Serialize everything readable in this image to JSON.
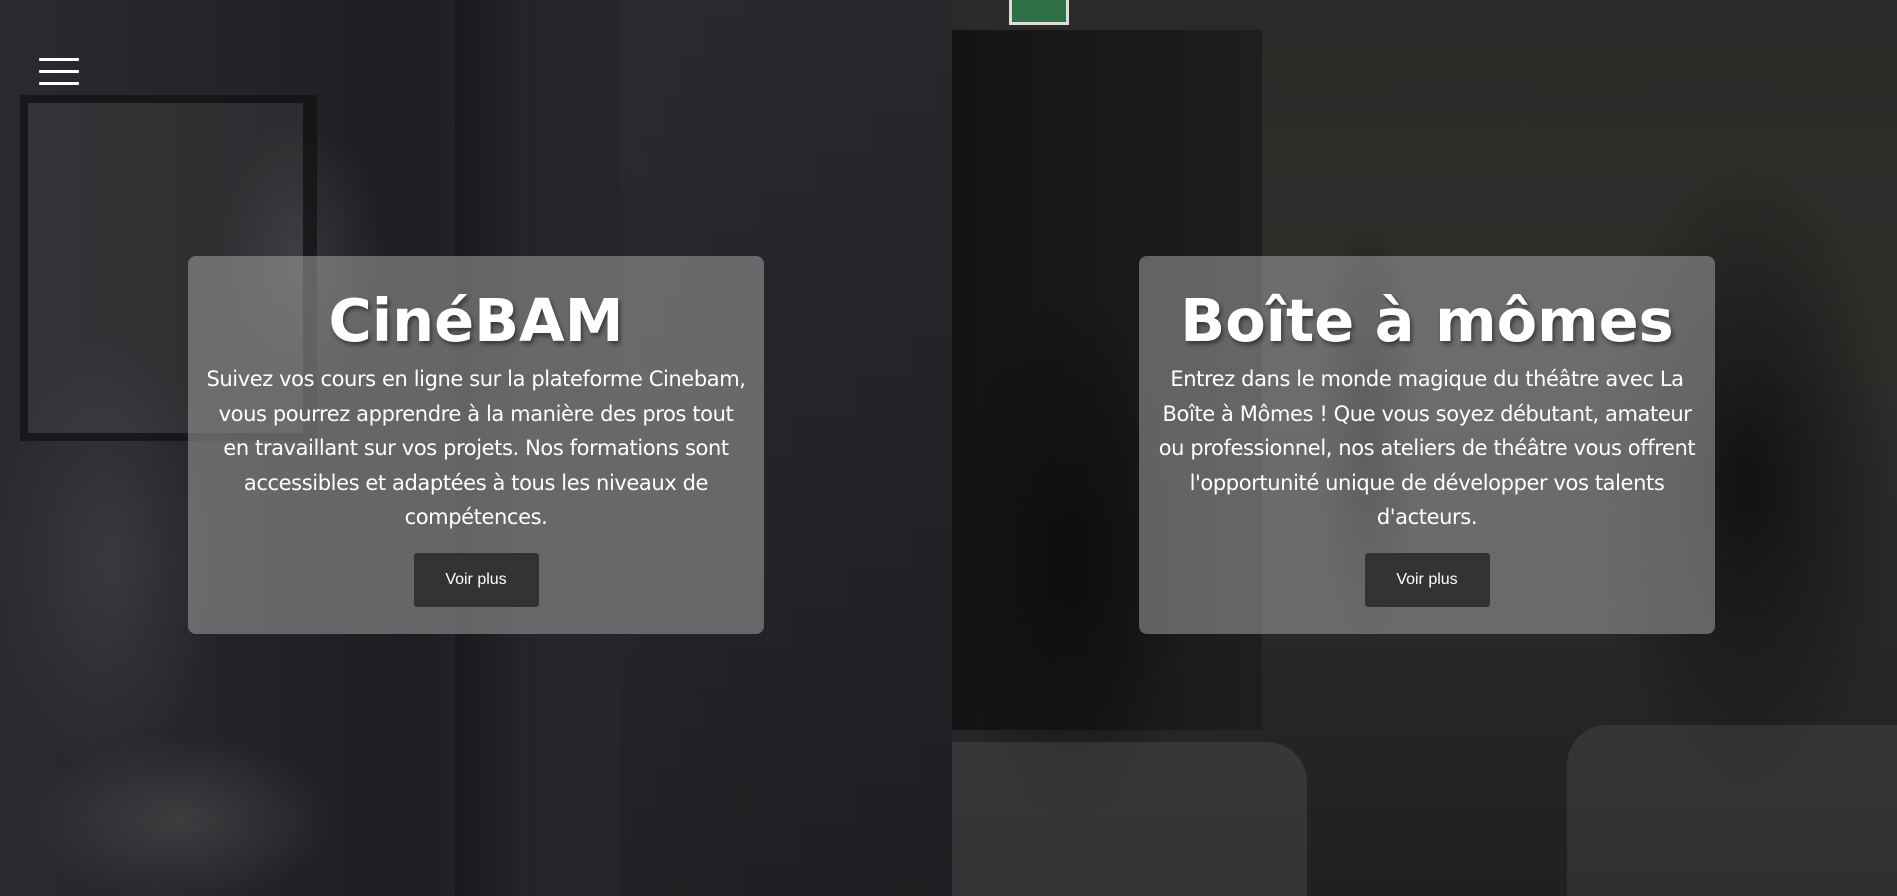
{
  "menu": {
    "icon": "hamburger-menu-icon"
  },
  "cards": [
    {
      "title": "CinéBAM",
      "description": "Suivez vos cours en ligne sur la plateforme Cinebam, vous pourrez apprendre à la manière des pros tout en travaillant sur vos projets. Nos formations sont accessibles et adaptées à tous les niveaux de compétences.",
      "button_label": "Voir plus"
    },
    {
      "title": "Boîte à mômes",
      "description": "Entrez dans le monde magique du théâtre avec La Boîte à Mômes ! Que vous soyez débutant, amateur ou professionnel, nos ateliers de théâtre vous offrent l'opportunité unique de développer vos talents d'acteurs.",
      "button_label": "Voir plus"
    }
  ],
  "colors": {
    "card_background": "#a0a0a0",
    "button_background": "#333333",
    "text": "#ffffff"
  }
}
